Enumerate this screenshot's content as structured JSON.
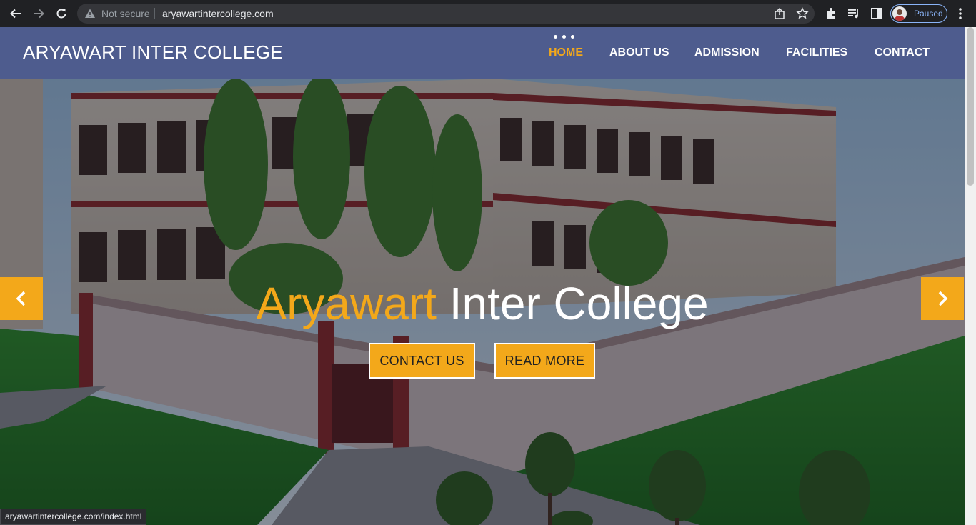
{
  "browser": {
    "security_label": "Not secure",
    "url": "aryawartintercollege.com",
    "profile_status": "Paused",
    "status_bar_url": "aryawartintercollege.com/index.html"
  },
  "site": {
    "brand": "ARYAWART INTER COLLEGE",
    "nav": {
      "home": "HOME",
      "about": "ABOUT US",
      "admission": "ADMISSION",
      "facilities": "FACILITIES",
      "contact": "CONTACT"
    }
  },
  "hero": {
    "title_part1": "Aryawart",
    "title_part2": "Inter College",
    "button_contact": "CONTACT US",
    "button_read_more": "READ MORE"
  },
  "colors": {
    "accent": "#f3a81a",
    "navbar": "#4e5c8e",
    "chrome": "#202124"
  },
  "icons": {
    "back": "arrow-left-icon",
    "forward": "arrow-right-icon",
    "reload": "reload-icon",
    "warning": "warning-triangle-icon",
    "share": "share-icon",
    "bookmark": "star-icon",
    "extensions": "puzzle-icon",
    "media": "media-queue-icon",
    "side_panel": "side-panel-icon",
    "menu": "kebab-menu-icon",
    "prev_slide": "chevron-left-icon",
    "next_slide": "chevron-right-icon"
  }
}
